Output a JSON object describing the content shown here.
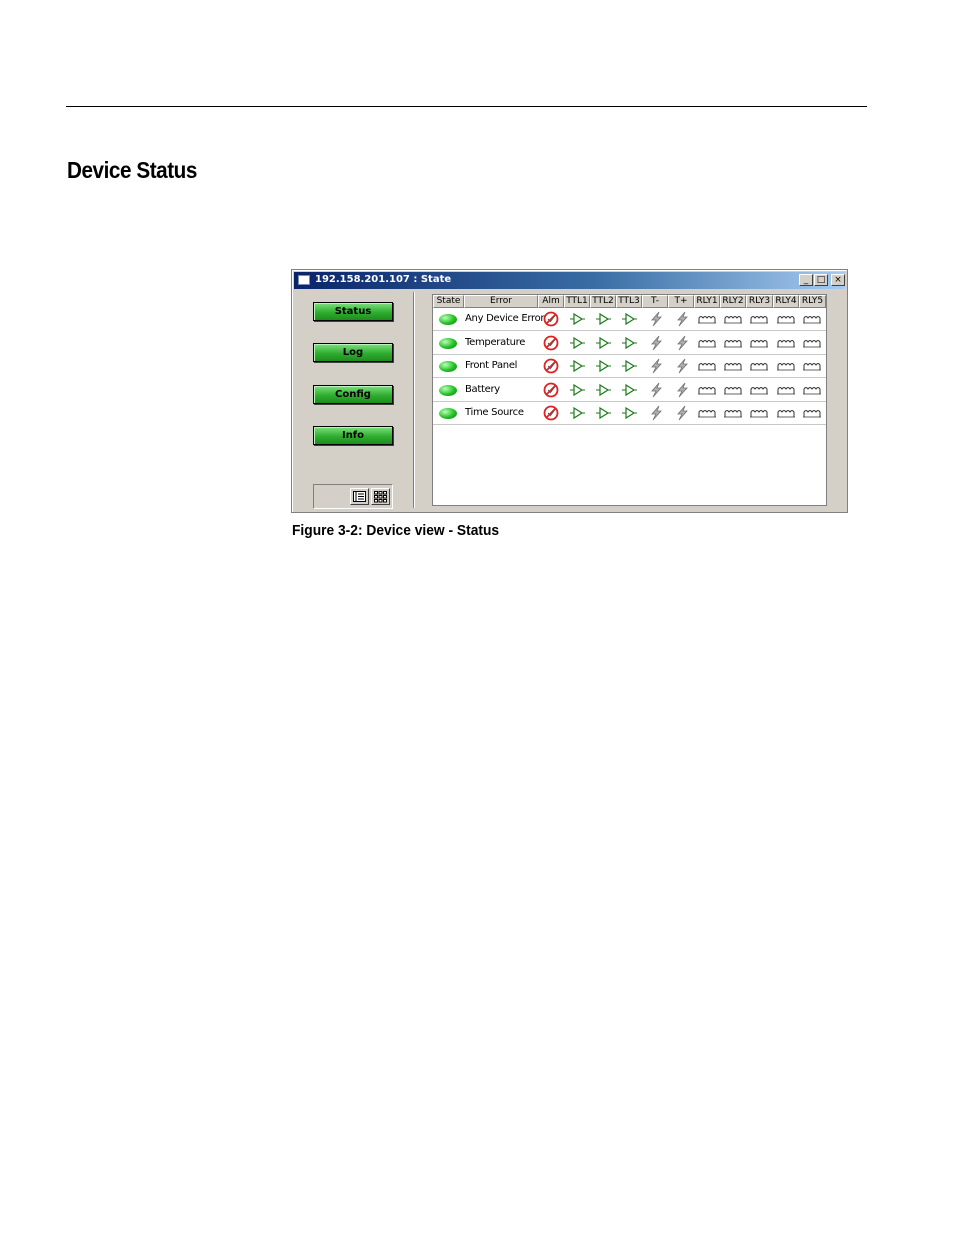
{
  "page": {
    "section_title": "Device Status",
    "figure_caption": "Figure 3-2: Device view - Status"
  },
  "window": {
    "title": "192.158.201.107 : State",
    "controls": {
      "minimize": "_",
      "maximize": "□",
      "close": "×"
    }
  },
  "sidebar": {
    "buttons": [
      {
        "label": "Status"
      },
      {
        "label": "Log"
      },
      {
        "label": "Config"
      },
      {
        "label": "Info"
      }
    ],
    "view_toggle": {
      "list_icon": "list-view-icon",
      "grid_icon": "grid-view-icon"
    }
  },
  "table": {
    "columns": [
      "State",
      "Error",
      "Alm",
      "TTL1",
      "TTL2",
      "TTL3",
      "T-",
      "T+",
      "RLY1",
      "RLY2",
      "RLY3",
      "RLY4",
      "RLY5"
    ],
    "rows": [
      {
        "error": "Any Device Error"
      },
      {
        "error": "Temperature"
      },
      {
        "error": "Front Panel"
      },
      {
        "error": "Battery"
      },
      {
        "error": "Time Source"
      }
    ],
    "icons": {
      "state": "green-led-icon",
      "alm": "no-alarm-icon",
      "ttl": "ttl-output-icon",
      "t": "timecode-bolt-icon",
      "rly": "relay-coil-icon"
    },
    "colors": {
      "led": "#22c022",
      "alarm": "#e02020",
      "ttl": "#1a7a1a",
      "button": "#2fae2f",
      "titlebar": "#0a246a"
    }
  }
}
